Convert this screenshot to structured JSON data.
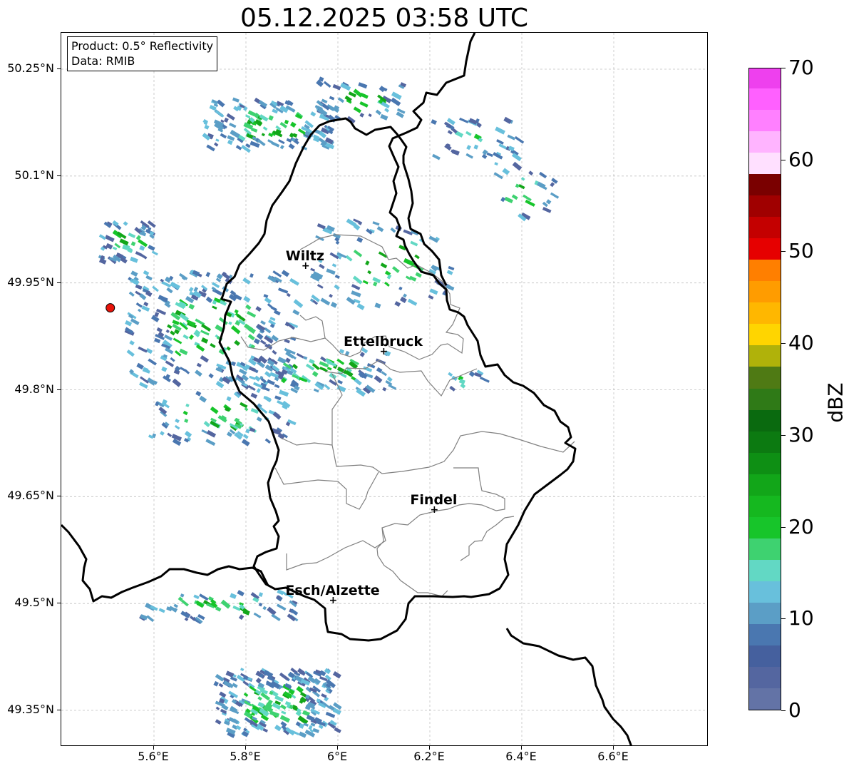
{
  "title": "05.12.2025 03:58 UTC",
  "info_box": {
    "product": "Product: 0.5° Reflectivity",
    "data": "Data: RMIB"
  },
  "lat_ticks": [
    {
      "label": "50.25°N",
      "value": 50.25
    },
    {
      "label": "50.1°N",
      "value": 50.1
    },
    {
      "label": "49.95°N",
      "value": 49.95
    },
    {
      "label": "49.8°N",
      "value": 49.8
    },
    {
      "label": "49.65°N",
      "value": 49.65
    },
    {
      "label": "49.5°N",
      "value": 49.5
    },
    {
      "label": "49.35°N",
      "value": 49.35
    }
  ],
  "lon_ticks": [
    {
      "label": "5.6°E",
      "value": 5.6
    },
    {
      "label": "5.8°E",
      "value": 5.8
    },
    {
      "label": "6°E",
      "value": 6.0
    },
    {
      "label": "6.2°E",
      "value": 6.2
    },
    {
      "label": "6.4°E",
      "value": 6.4
    },
    {
      "label": "6.6°E",
      "value": 6.6
    }
  ],
  "cities": [
    {
      "name": "Wiltz",
      "lon": 5.93,
      "lat": 49.97
    },
    {
      "name": "Ettelbruck",
      "lon": 6.1,
      "lat": 49.85
    },
    {
      "name": "Findel",
      "lon": 6.21,
      "lat": 49.627
    },
    {
      "name": "Esch/Alzette",
      "lon": 5.99,
      "lat": 49.5
    }
  ],
  "radar_site": {
    "lon": 5.505,
    "lat": 49.915,
    "color": "#e8140a"
  },
  "colorbar": {
    "unit": "dBZ",
    "min": 0,
    "max": 70,
    "ticks": [
      {
        "label": "70",
        "value": 70
      },
      {
        "label": "60",
        "value": 60
      },
      {
        "label": "50",
        "value": 50
      },
      {
        "label": "40",
        "value": 40
      },
      {
        "label": "30",
        "value": 30
      },
      {
        "label": "20",
        "value": 20
      },
      {
        "label": "10",
        "value": 10
      },
      {
        "label": "0",
        "value": 0
      }
    ],
    "colors": [
      "#6373a6",
      "#5466a0",
      "#45609e",
      "#4a77b0",
      "#5b9ec6",
      "#68c0dc",
      "#62d8c4",
      "#3ed270",
      "#17c52a",
      "#15b81f",
      "#12a619",
      "#0e8f14",
      "#0c7a11",
      "#0a6a0f",
      "#2f7a17",
      "#4f7a14",
      "#b0b20a",
      "#ffd500",
      "#ffb700",
      "#ff9c00",
      "#ff7f00",
      "#e60000",
      "#c40000",
      "#a00000",
      "#7a0000",
      "#ffe0ff",
      "#ffb4ff",
      "#ff80ff",
      "#ff60ff",
      "#ee40ee"
    ]
  },
  "map": {
    "lon_range": [
      5.4,
      6.8
    ],
    "lat_range": [
      49.3,
      50.3
    ]
  }
}
